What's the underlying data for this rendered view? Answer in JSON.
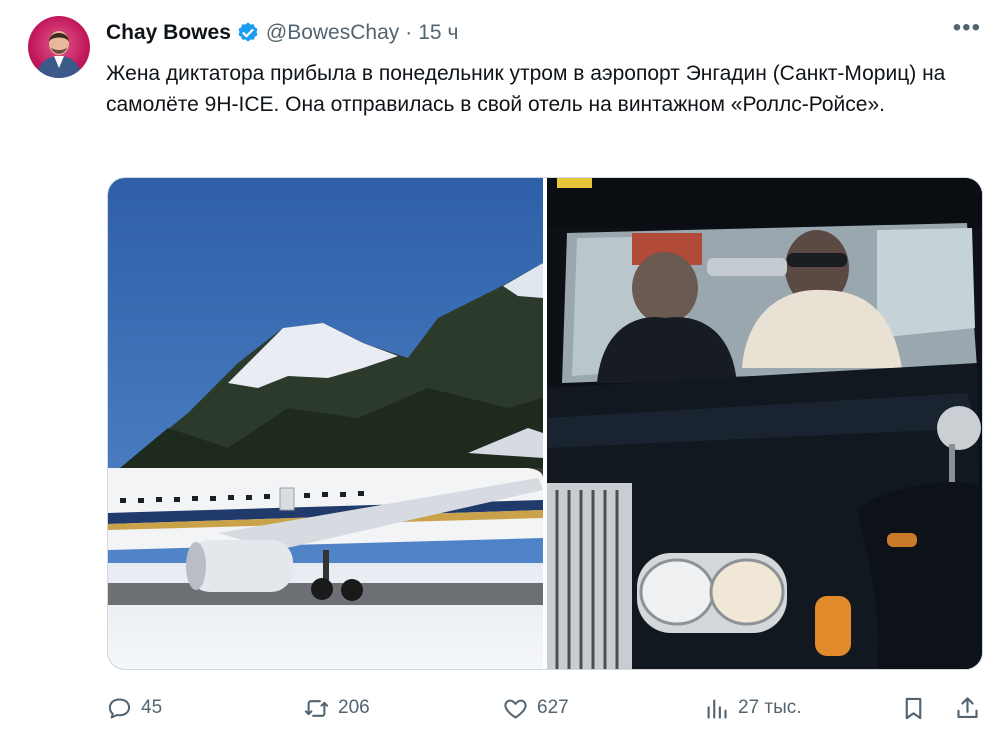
{
  "tweet": {
    "author_name": "Chay Bowes",
    "handle": "@BowesChay",
    "separator": "·",
    "time": "15 ч",
    "more_label": "•••",
    "text": "Жена диктатора прибыла в понедельник утром в аэропорт Энгадин (Санкт-Мориц) на самолёте 9H-ICE. Она отправилась в свой отель на винтажном «Роллс-Ройсе»."
  },
  "media": {
    "image_1_subject": "airliner-on-snowy-apron-mountains",
    "image_2_subject": "vintage-rolls-royce-with-driver-and-passenger"
  },
  "actions": {
    "replies": "45",
    "retweets": "206",
    "likes": "627",
    "views": "27 тыс."
  },
  "colors": {
    "verified": "#1d9bf0",
    "muted": "#536471",
    "text": "#0f1419"
  }
}
